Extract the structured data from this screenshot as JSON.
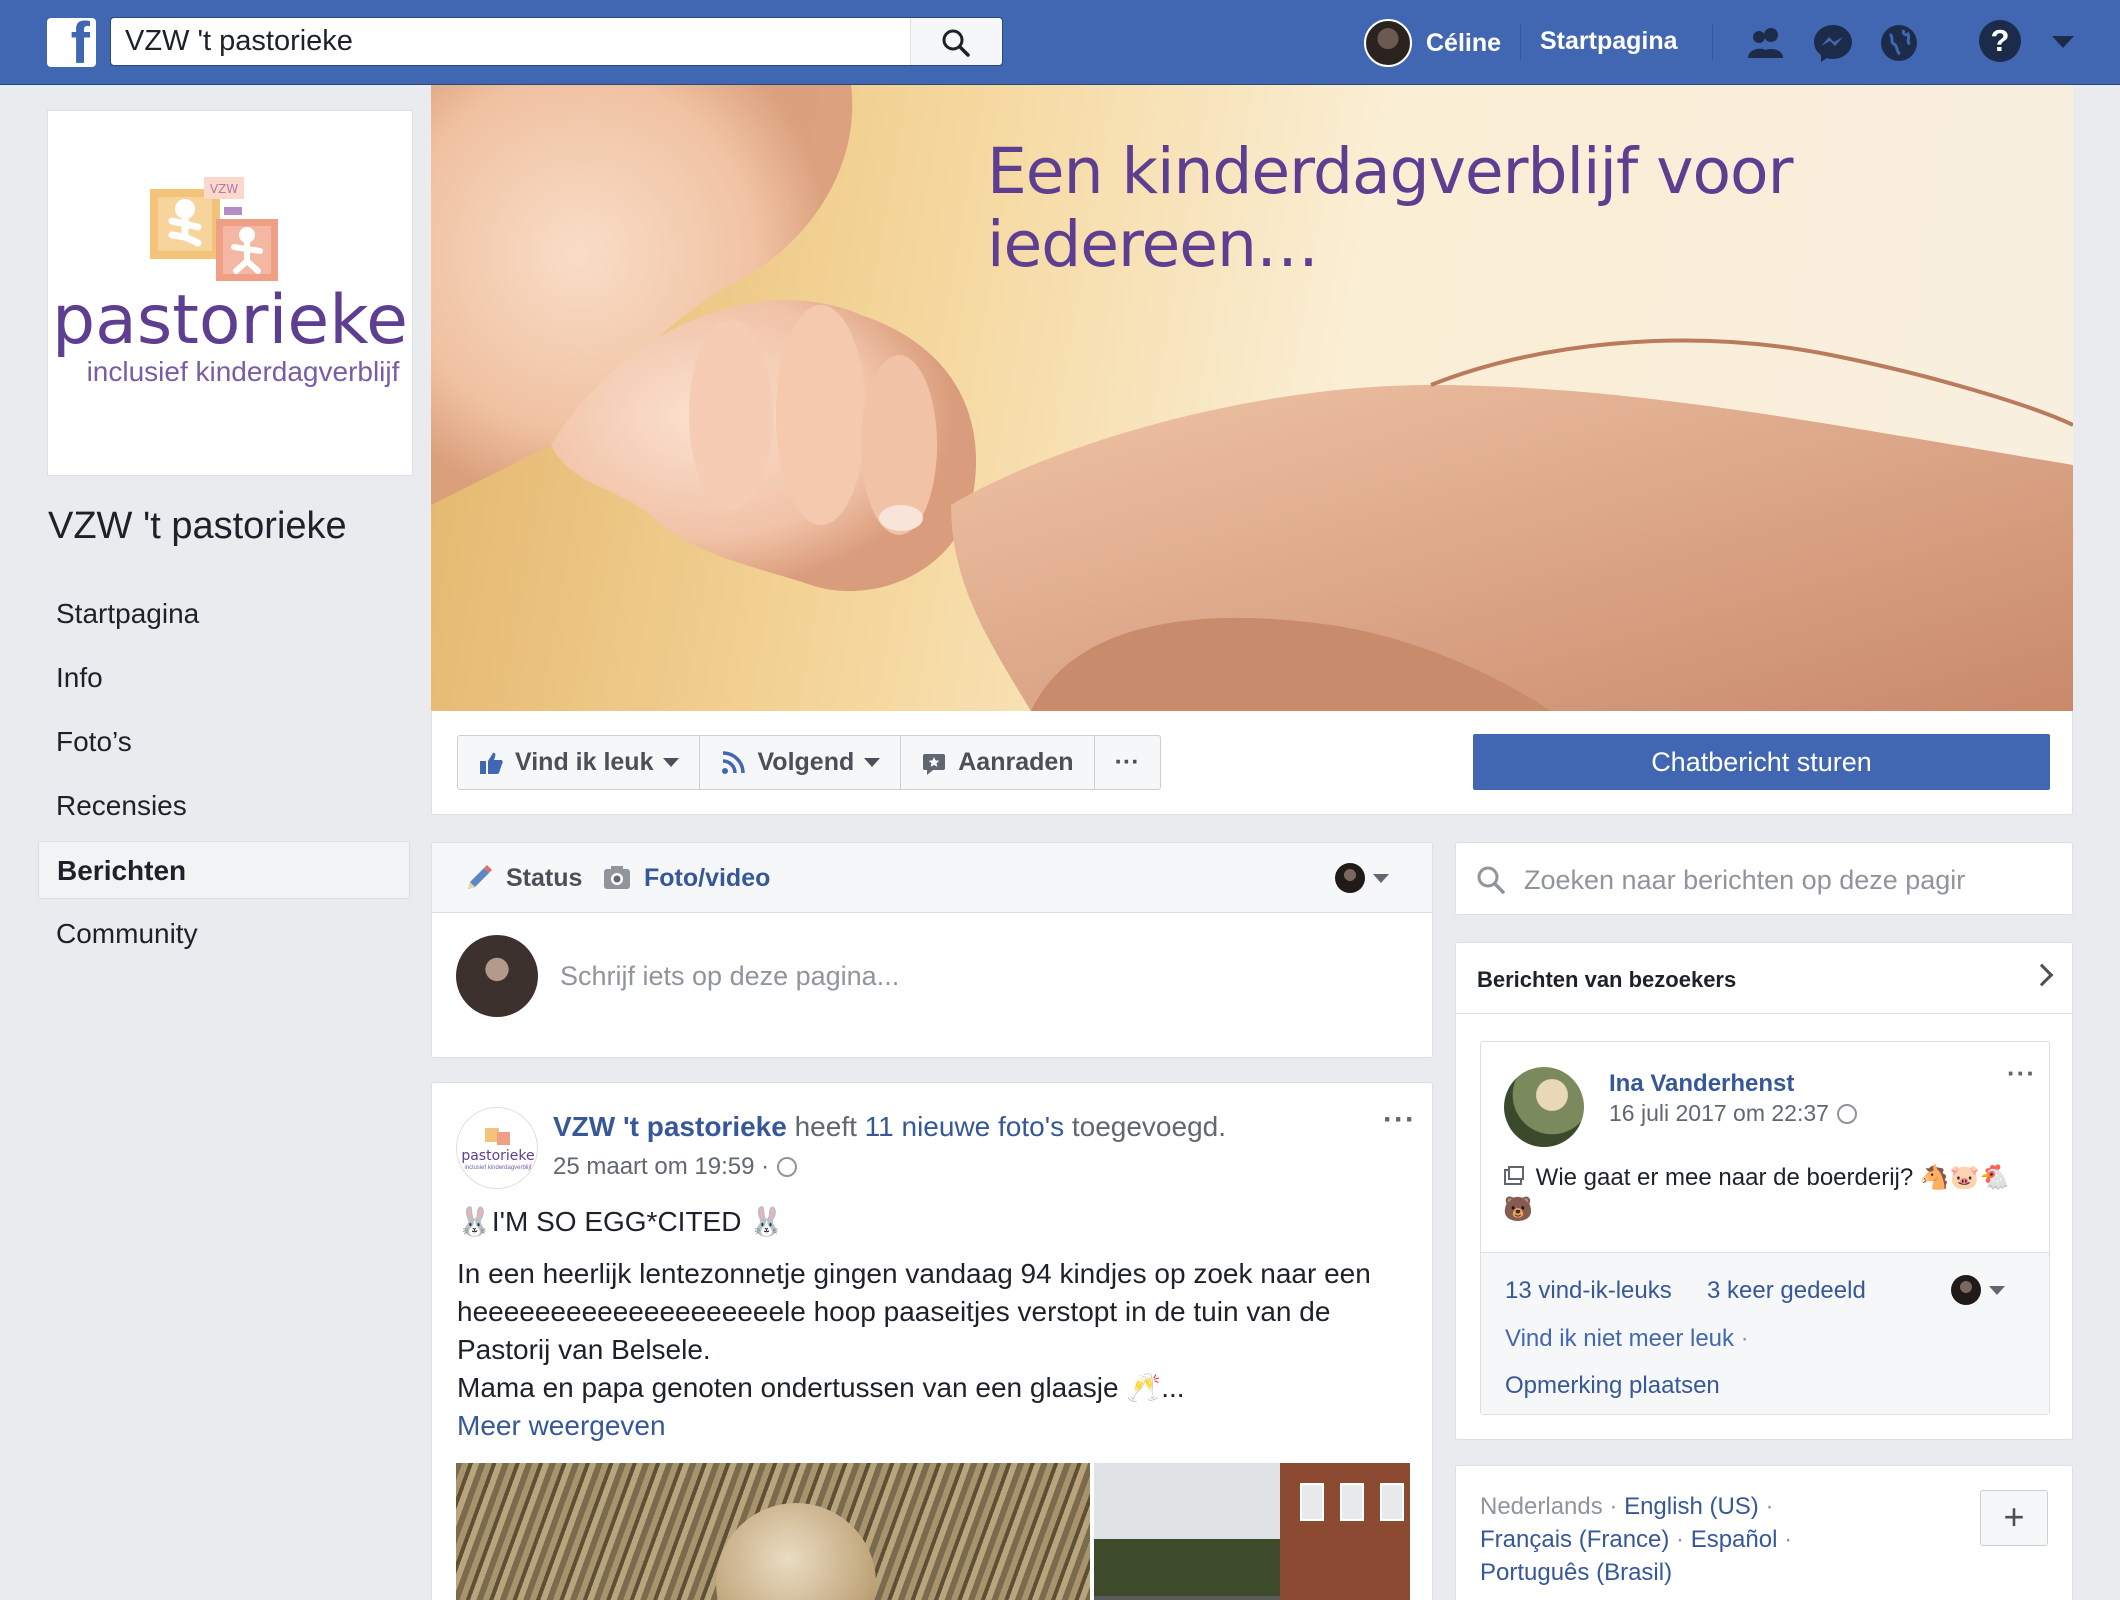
{
  "topbar": {
    "logo": "f",
    "search_value": "VZW 't pastorieke",
    "user_name": "Céline",
    "home_label": "Startpagina",
    "help": "?",
    "icons": [
      "friends-icon",
      "messenger-icon",
      "notifications-globe-icon",
      "help-icon",
      "account-menu-caret"
    ]
  },
  "page": {
    "name": "VZW 't pastorieke",
    "logo_wordmark": "pastorieke",
    "logo_sub": "inclusief kinderdagverblijf",
    "logo_block_label": "VZW"
  },
  "left_nav": [
    {
      "label": "Startpagina",
      "active": false
    },
    {
      "label": "Info",
      "active": false
    },
    {
      "label": "Foto’s",
      "active": false
    },
    {
      "label": "Recensies",
      "active": false
    },
    {
      "label": "Berichten",
      "active": true
    },
    {
      "label": "Community",
      "active": false
    }
  ],
  "cover": {
    "tagline": "Een kinderdagverblijf voor iedereen…"
  },
  "actions": {
    "like": "Vind ik leuk",
    "follow": "Volgend",
    "recommend": "Aanraden",
    "more": "···",
    "message": "Chatbericht sturen"
  },
  "composer": {
    "tab_status": "Status",
    "tab_photo": "Foto/video",
    "placeholder": "Schrijf iets op deze pagina..."
  },
  "post": {
    "author": "VZW 't pastorieke",
    "verb": "heeft",
    "link": "11 nieuwe foto's",
    "suffix": "toegevoegd.",
    "date": "25 maart om 19:59 ·",
    "more": "···",
    "headline": "🐰I'M SO EGG*CITED 🐰",
    "body_lines": [
      "In een heerlijk lentezonnetje gingen vandaag 94 kindjes op zoek naar een",
      "heeeeeeeeeeeeeeeeeeeele hoop paaseitjes verstopt in de tuin van de",
      "Pastorij van Belsele.",
      "Mama en papa genoten ondertussen van een glaasje 🥂..."
    ],
    "see_more": "Meer weergeven"
  },
  "right": {
    "search_placeholder": "Zoeken naar berichten op deze pagir",
    "visitors_title": "Berichten van bezoekers",
    "visitor_post": {
      "name": "Ina Vanderhenst",
      "date": "16 juli 2017 om 22:37",
      "more": "···",
      "text": "Wie gaat er mee naar de boerderij? 🐴🐷🐔🐻",
      "likes": "13 vind-ik-leuks",
      "shares": "3 keer gedeeld",
      "unlike": "Vind ik niet meer leuk",
      "comment": "Opmerking plaatsen"
    },
    "languages": {
      "current": "Nederlands",
      "others": [
        "English (US)",
        "Français (France)",
        "Español",
        "Português (Brasil)"
      ],
      "add": "+"
    }
  },
  "colors": {
    "brand_blue": "#4267b2",
    "link_blue": "#365899",
    "tagline_purple": "#5e3e91",
    "page_bg": "#e9ebee"
  }
}
